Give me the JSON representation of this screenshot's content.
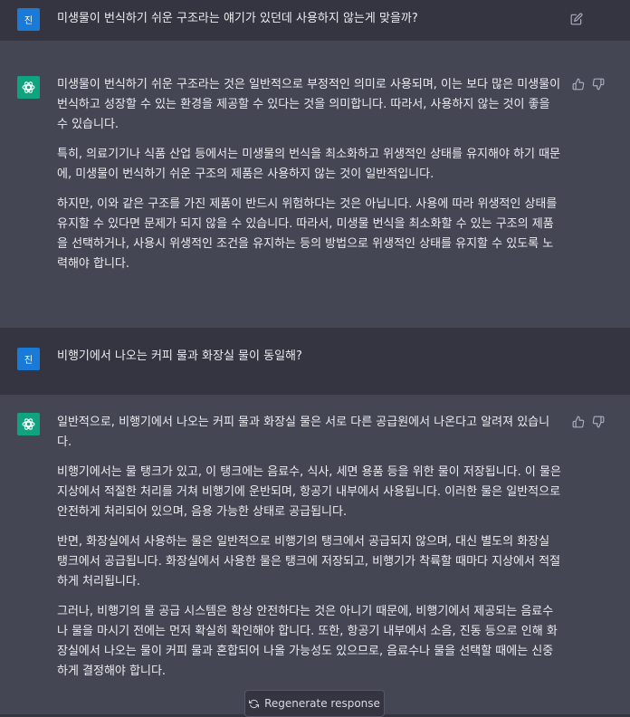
{
  "conversation": {
    "user_avatar_label": "진",
    "messages": [
      {
        "role": "user",
        "text": "미생물이 번식하기 쉬운 구조라는 얘기가 있던데 사용하지 않는게 맞을까?"
      },
      {
        "role": "assistant",
        "paragraphs": [
          "미생물이 번식하기 쉬운 구조라는 것은 일반적으로 부정적인 의미로 사용되며, 이는 보다 많은 미생물이 번식하고 성장할 수 있는 환경을 제공할 수 있다는 것을 의미합니다. 따라서, 사용하지 않는 것이 좋을 수 있습니다.",
          "특히, 의료기기나 식품 산업 등에서는 미생물의 번식을 최소화하고 위생적인 상태를 유지해야 하기 때문에, 미생물이 번식하기 쉬운 구조의 제품은 사용하지 않는 것이 일반적입니다.",
          "하지만, 이와 같은 구조를 가진 제품이 반드시 위험하다는 것은 아닙니다. 사용에 따라 위생적인 상태를 유지할 수 있다면 문제가 되지 않을 수 있습니다. 따라서, 미생물 번식을 최소화할 수 있는 구조의 제품을 선택하거나, 사용시 위생적인 조건을 유지하는 등의 방법으로 위생적인 상태를 유지할 수 있도록 노력해야 합니다."
        ]
      },
      {
        "role": "user",
        "text": "비행기에서 나오는 커피 물과 화장실 물이 동일해?"
      },
      {
        "role": "assistant",
        "paragraphs": [
          "일반적으로, 비행기에서 나오는 커피 물과 화장실 물은 서로 다른 공급원에서 나온다고 알려져 있습니다.",
          "비행기에서는 물 탱크가 있고, 이 탱크에는 음료수, 식사, 세면 용품 등을 위한 물이 저장됩니다. 이 물은 지상에서 적절한 처리를 거쳐 비행기에 운반되며, 항공기 내부에서 사용됩니다. 이러한 물은 일반적으로 안전하게 처리되어 있으며, 음용 가능한 상태로 공급됩니다.",
          "반면, 화장실에서 사용하는 물은 일반적으로 비행기의 탱크에서 공급되지 않으며, 대신 별도의 화장실 탱크에서 공급됩니다. 화장실에서 사용한 물은 탱크에 저장되고, 비행기가 착륙할 때마다 지상에서 적절하게 처리됩니다.",
          "그러나, 비행기의 물 공급 시스템은 항상 안전하다는 것은 아니기 때문에, 비행기에서 제공되는 음료수나 물을 마시기 전에는 먼저 확실히 확인해야 합니다. 또한, 항공기 내부에서 소음, 진동 등으로 인해 화장실에서 나오는 물이 커피 물과 혼합되어 나올 가능성도 있으므로, 음료수나 물을 선택할 때에는 신중하게 결정해야 합니다."
        ]
      }
    ]
  },
  "icons": {
    "edit": "edit-icon",
    "thumbs_up": "thumbs-up-icon",
    "thumbs_down": "thumbs-down-icon",
    "openai_logo": "openai-logo-icon",
    "refresh": "refresh-icon"
  },
  "actions": {
    "regenerate_label": "Regenerate response"
  },
  "colors": {
    "user_bg": "#343541",
    "assistant_bg": "#444654",
    "user_avatar": "#1a7ad8",
    "bot_avatar": "#10a37f",
    "text": "#ececf1"
  }
}
